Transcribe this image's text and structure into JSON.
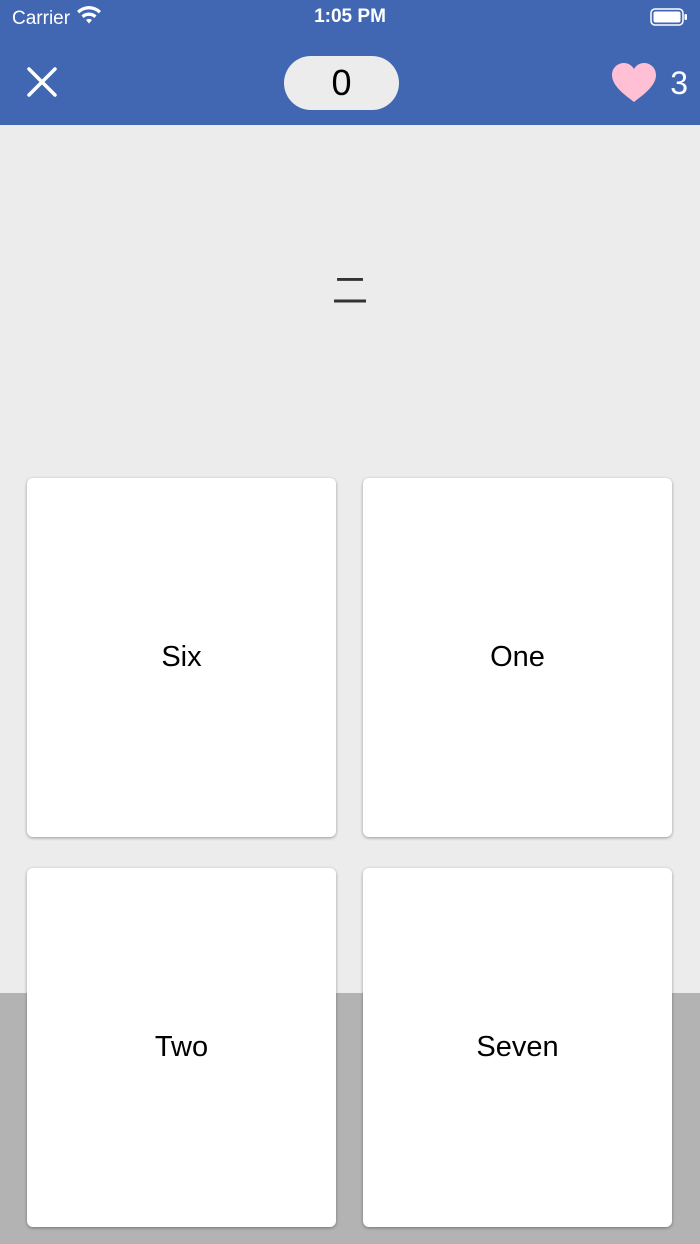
{
  "status_bar": {
    "carrier": "Carrier",
    "time": "1:05 PM",
    "icons": [
      "wifi-icon",
      "battery-icon"
    ]
  },
  "header": {
    "score": "0",
    "lives": "3",
    "close_icon": "close-icon",
    "lives_icon": "heart-icon",
    "colors": {
      "header_bg": "#4167b3",
      "heart": "#ffc0d6"
    }
  },
  "question": {
    "prompt": "二"
  },
  "answers": [
    {
      "label": "Six"
    },
    {
      "label": "One"
    },
    {
      "label": "Two"
    },
    {
      "label": "Seven"
    }
  ]
}
